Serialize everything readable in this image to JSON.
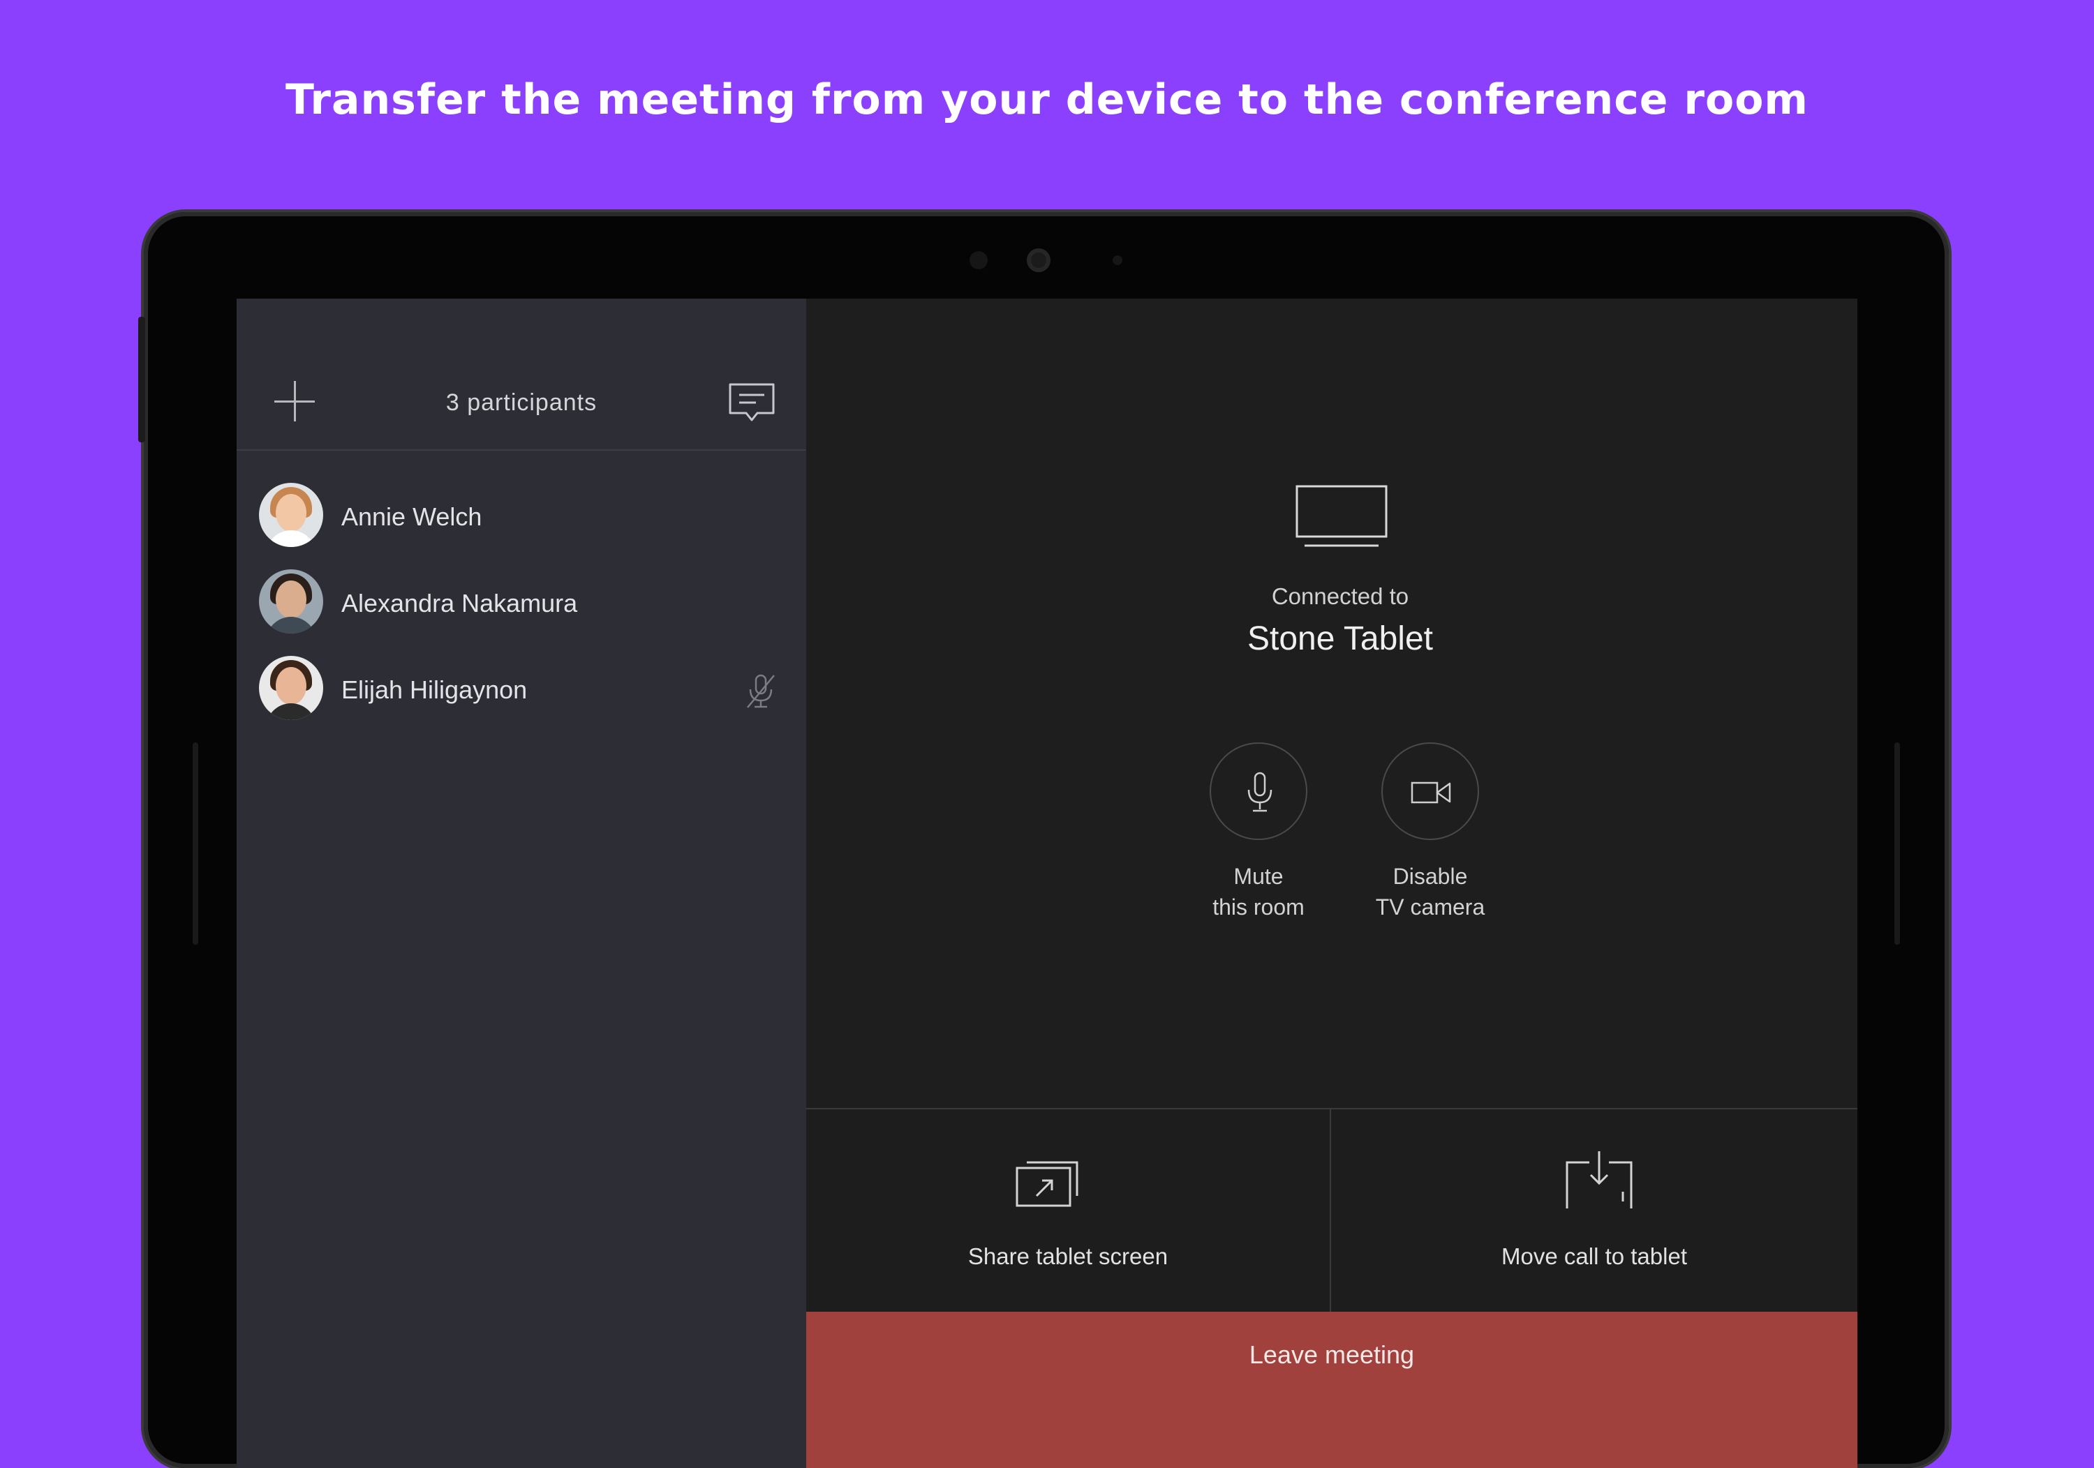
{
  "headline": "Transfer the meeting from your device to the conference room",
  "sidebar": {
    "add_icon": "plus-icon",
    "title": "3 participants",
    "chat_icon": "chat-icon",
    "participants": [
      {
        "name": "Annie Welch",
        "muted": false
      },
      {
        "name": "Alexandra Nakamura",
        "muted": false
      },
      {
        "name": "Elijah Hiligaynon",
        "muted": true
      }
    ]
  },
  "main": {
    "device_icon": "tv-icon",
    "connected_label": "Connected to",
    "room_name": "Stone Tablet",
    "controls": [
      {
        "icon": "microphone-icon",
        "label_line1": "Mute",
        "label_line2": "this room"
      },
      {
        "icon": "video-camera-icon",
        "label_line1": "Disable",
        "label_line2": "TV camera"
      }
    ],
    "actions": [
      {
        "icon": "share-screen-icon",
        "label": "Share tablet screen"
      },
      {
        "icon": "move-call-icon",
        "label": "Move call to tablet"
      }
    ],
    "leave_label": "Leave meeting"
  },
  "colors": {
    "background": "#8b40fe",
    "sidebar": "#2c2d35",
    "main_panel": "#1e1e1e",
    "leave_button": "#a1413d"
  }
}
